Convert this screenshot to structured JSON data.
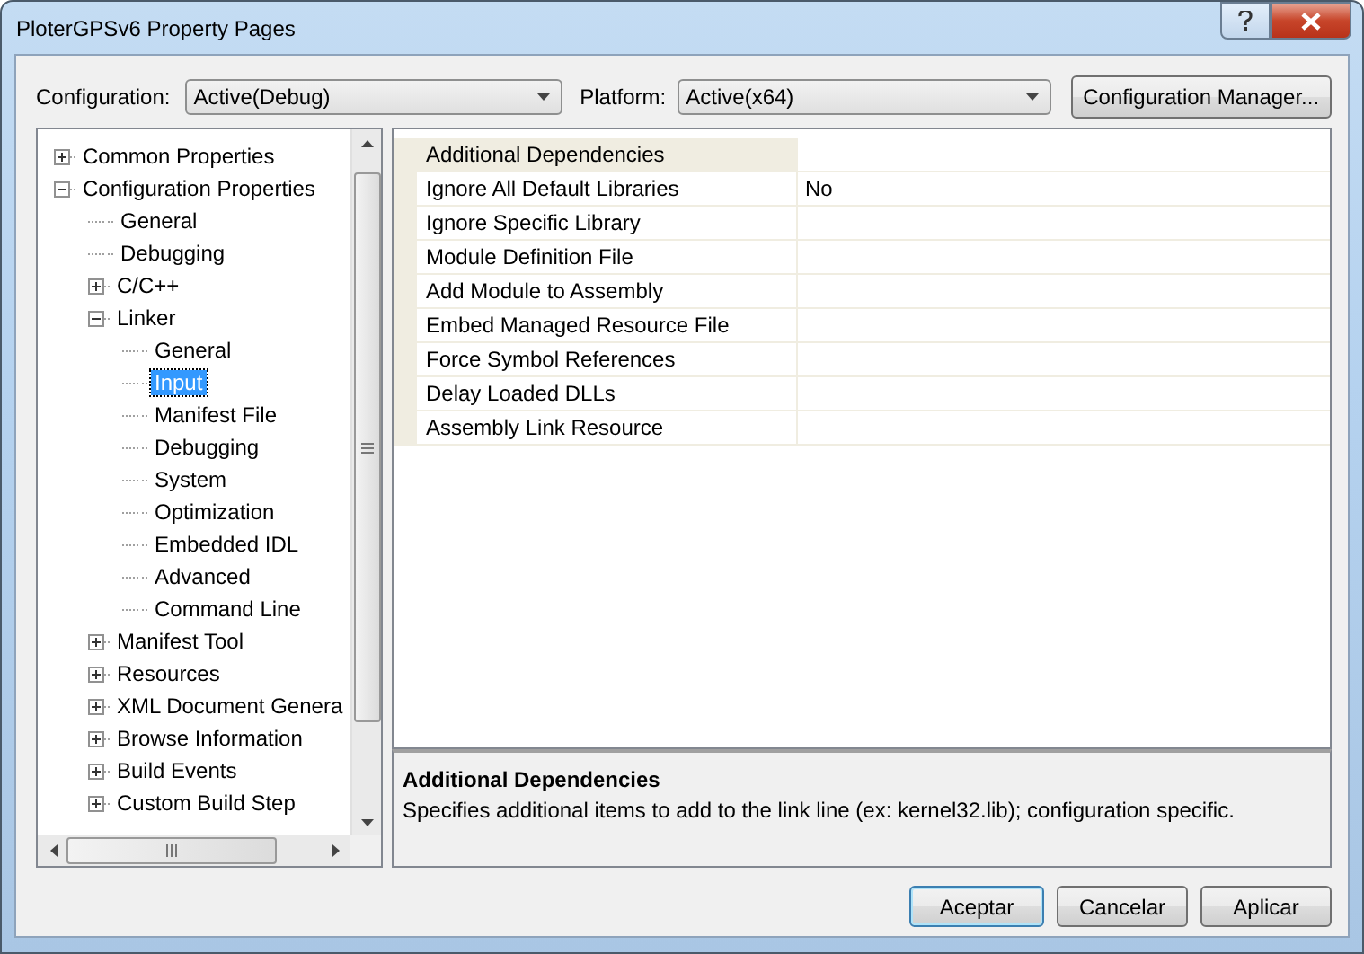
{
  "window": {
    "title": "PloterGPSv6 Property Pages"
  },
  "selectors": [
    {
      "label": "Configuration:",
      "value": "Active(Debug)"
    },
    {
      "label": "Platform:",
      "value": "Active(x64)"
    }
  ],
  "manager_button": "Configuration Manager...",
  "tree": [
    {
      "label": "Common Properties",
      "expanded": false,
      "selected": false
    },
    {
      "label": "Configuration Properties",
      "expanded": true,
      "selected": false,
      "children": [
        {
          "label": "General",
          "selected": false
        },
        {
          "label": "Debugging",
          "selected": false
        },
        {
          "label": "C/C++",
          "expanded": false,
          "selected": false
        },
        {
          "label": "Linker",
          "expanded": true,
          "selected": false,
          "children": [
            {
              "label": "General",
              "selected": false
            },
            {
              "label": "Input",
              "selected": true
            },
            {
              "label": "Manifest File",
              "selected": false
            },
            {
              "label": "Debugging",
              "selected": false
            },
            {
              "label": "System",
              "selected": false
            },
            {
              "label": "Optimization",
              "selected": false
            },
            {
              "label": "Embedded IDL",
              "selected": false
            },
            {
              "label": "Advanced",
              "selected": false
            },
            {
              "label": "Command Line",
              "selected": false
            }
          ]
        },
        {
          "label": "Manifest Tool",
          "expanded": false,
          "selected": false
        },
        {
          "label": "Resources",
          "expanded": false,
          "selected": false
        },
        {
          "label": "XML Document Genera",
          "expanded": false,
          "selected": false
        },
        {
          "label": "Browse Information",
          "expanded": false,
          "selected": false
        },
        {
          "label": "Build Events",
          "expanded": false,
          "selected": false
        },
        {
          "label": "Custom Build Step",
          "expanded": false,
          "selected": false
        }
      ]
    }
  ],
  "grid": {
    "rows": [
      {
        "name": "Additional Dependencies",
        "value": "",
        "selected": true
      },
      {
        "name": "Ignore All Default Libraries",
        "value": "No",
        "selected": false
      },
      {
        "name": "Ignore Specific Library",
        "value": "",
        "selected": false
      },
      {
        "name": "Module Definition File",
        "value": "",
        "selected": false
      },
      {
        "name": "Add Module to Assembly",
        "value": "",
        "selected": false
      },
      {
        "name": "Embed Managed Resource File",
        "value": "",
        "selected": false
      },
      {
        "name": "Force Symbol References",
        "value": "",
        "selected": false
      },
      {
        "name": "Delay Loaded DLLs",
        "value": "",
        "selected": false
      },
      {
        "name": "Assembly Link Resource",
        "value": "",
        "selected": false
      }
    ]
  },
  "description": {
    "title": "Additional Dependencies",
    "text": "Specifies additional items to add to the link line (ex: kernel32.lib); configuration specific."
  },
  "buttons": [
    {
      "label": "Aceptar",
      "default": true
    },
    {
      "label": "Cancelar",
      "default": false
    },
    {
      "label": "Aplicar",
      "default": false
    }
  ]
}
